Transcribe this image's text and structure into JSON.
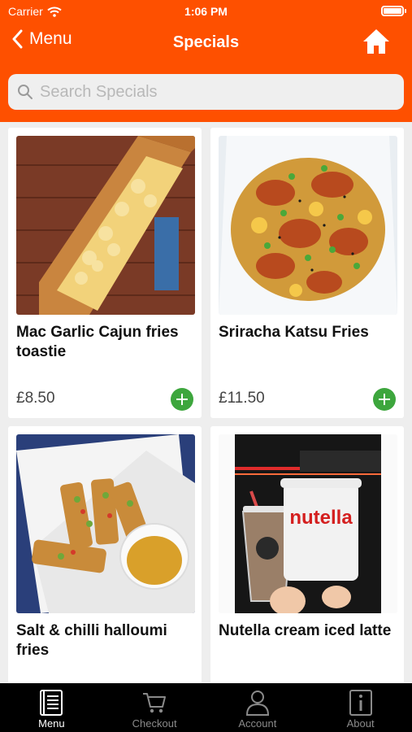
{
  "status_bar": {
    "carrier": "Carrier",
    "time": "1:06 PM"
  },
  "nav": {
    "back_label": "Menu",
    "title": "Specials"
  },
  "search": {
    "placeholder": "Search Specials",
    "value": ""
  },
  "products": [
    {
      "name": "Mac Garlic Cajun fries toastie",
      "price": "£8.50"
    },
    {
      "name": "Sriracha Katsu Fries",
      "price": "£11.50"
    },
    {
      "name": "Salt & chilli halloumi fries",
      "price": ""
    },
    {
      "name": "Nutella cream iced latte",
      "price": ""
    }
  ],
  "tabs": [
    {
      "label": "Menu",
      "icon": "menu-book-icon"
    },
    {
      "label": "Checkout",
      "icon": "cart-icon"
    },
    {
      "label": "Account",
      "icon": "person-icon"
    },
    {
      "label": "About",
      "icon": "info-icon"
    }
  ],
  "colors": {
    "brand": "#fe5000",
    "add_button": "#3da63d",
    "tab_bar": "#000000",
    "tab_active": "#ffffff",
    "tab_inactive": "#8a8a8a"
  }
}
